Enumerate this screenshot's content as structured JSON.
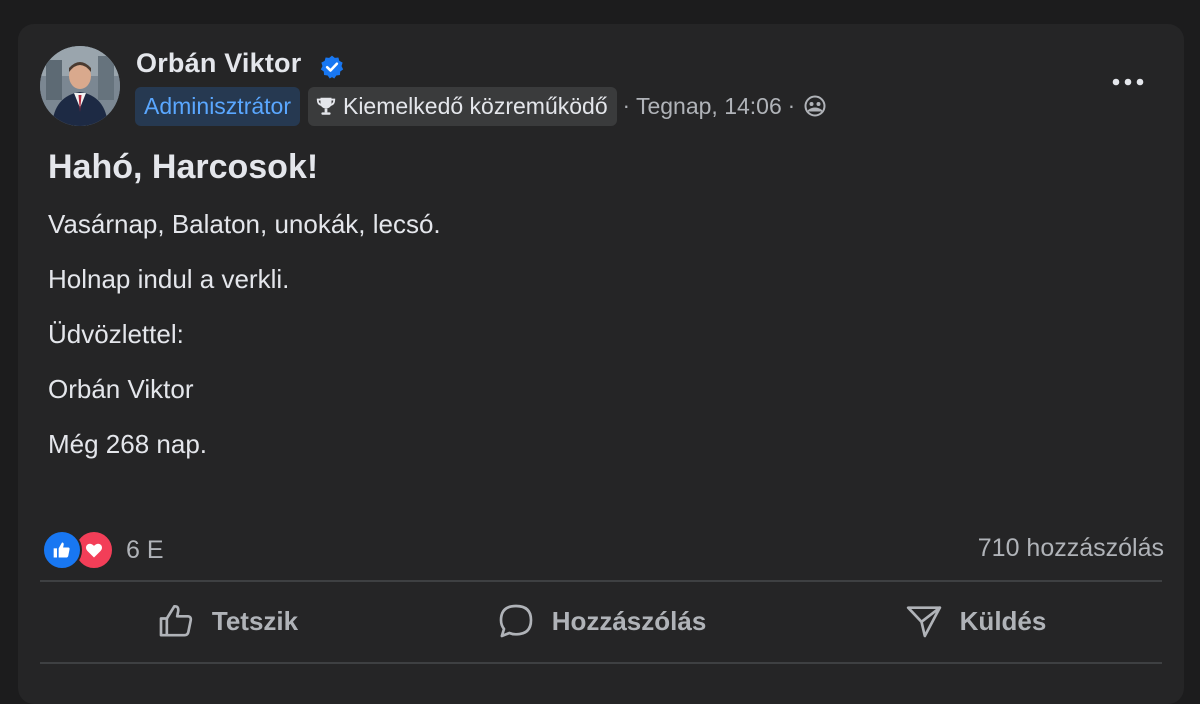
{
  "post": {
    "author": {
      "name": "Orbán Viktor",
      "verified": true
    },
    "badges": {
      "admin": "Adminisztrátor",
      "contributor": "Kiemelkedő közreműködő"
    },
    "meta": {
      "separator": "·",
      "time": "Tegnap, 14:06",
      "audience_icon": "group-icon"
    },
    "title": "Hahó, Harcosok!",
    "lines": [
      "Vasárnap, Balaton, unokák, lecsó.",
      "Holnap indul a verkli.",
      "Üdvözlettel:",
      "Orbán Viktor",
      "Még 268 nap."
    ],
    "reactions": {
      "types": [
        "like",
        "love"
      ],
      "count": "6 E"
    },
    "comments": {
      "count_label": "710 hozzászólás"
    },
    "actions": {
      "like": "Tetszik",
      "comment": "Hozzászólás",
      "send": "Küldés"
    }
  },
  "colors": {
    "background": "#1c1c1d",
    "card": "#252526",
    "text": "#e4e6eb",
    "secondary_text": "#b0b3b8",
    "accent": "#1877f2",
    "love": "#f33e58",
    "admin_badge_bg": "#263951",
    "admin_badge_text": "#5aa7ff"
  }
}
